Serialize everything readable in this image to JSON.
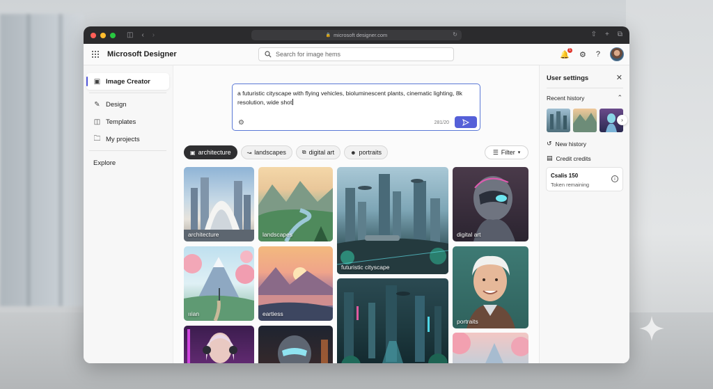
{
  "browser": {
    "url": "microsoft designer.com"
  },
  "app": {
    "title": "Microsoft Designer",
    "search_placeholder": "Search for image hems",
    "notification_count": "1"
  },
  "sidebar": {
    "items": [
      {
        "label": "Image Creator",
        "icon": "image-icon"
      },
      {
        "label": "Design",
        "icon": "pen-icon"
      },
      {
        "label": "Templates",
        "icon": "template-icon"
      },
      {
        "label": "My projects",
        "icon": "folder-icon"
      }
    ],
    "explore_label": "Explore"
  },
  "prompt": {
    "text": "a futuristic cityscape with flying vehicles, bioluminescent plants, cinematic lighting, 8k resolution, wide shot",
    "count": "281/20"
  },
  "chips": [
    {
      "label": "architecture",
      "active": true
    },
    {
      "label": "landscapes",
      "active": false
    },
    {
      "label": "digital art",
      "active": false
    },
    {
      "label": "portraits",
      "active": false
    }
  ],
  "filter_label": "Filter",
  "tiles": {
    "architecture": "architecture",
    "landscapes": "landscapes",
    "futuristic": "futuristic cityscape",
    "digital_art": "digital art",
    "mountain": "ııian",
    "sunset": "eartiess",
    "portraits": "portraits"
  },
  "panel": {
    "title": "User settings",
    "recent_history": "Recent history",
    "new_history": "New history",
    "credit_credits": "Credit credits",
    "credits_main": "Csalis 150",
    "credits_sub": "Token remaining"
  },
  "colors": {
    "accent": "#5560d8",
    "prompt_border": "#5a78d6",
    "active_chip": "#2f2f31"
  }
}
